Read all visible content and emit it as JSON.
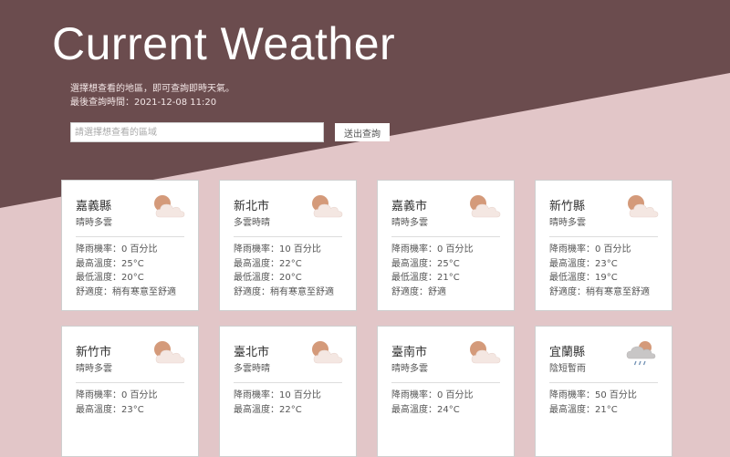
{
  "header": {
    "title": "Current Weather",
    "desc_line1": "選擇想查看的地區，即可查詢即時天氣。",
    "desc_line2": "最後查詢時間：2021-12-08 11:20"
  },
  "search": {
    "placeholder": "請選擇想查看的區域",
    "button_label": "送出查詢"
  },
  "cards": [
    {
      "city": "嘉義縣",
      "condition": "晴時多雲",
      "icon": "partly-cloudy-icon",
      "rain": "降雨機率：0 百分比",
      "max": "最高溫度：25°C",
      "min": "最低溫度：20°C",
      "comfort": "舒適度：稍有寒意至舒適"
    },
    {
      "city": "新北市",
      "condition": "多雲時晴",
      "icon": "partly-cloudy-icon",
      "rain": "降雨機率：10 百分比",
      "max": "最高溫度：22°C",
      "min": "最低溫度：20°C",
      "comfort": "舒適度：稍有寒意至舒適"
    },
    {
      "city": "嘉義市",
      "condition": "晴時多雲",
      "icon": "partly-cloudy-icon",
      "rain": "降雨機率：0 百分比",
      "max": "最高溫度：25°C",
      "min": "最低溫度：21°C",
      "comfort": "舒適度：舒適"
    },
    {
      "city": "新竹縣",
      "condition": "晴時多雲",
      "icon": "partly-cloudy-icon",
      "rain": "降雨機率：0 百分比",
      "max": "最高溫度：23°C",
      "min": "最低溫度：19°C",
      "comfort": "舒適度：稍有寒意至舒適"
    },
    {
      "city": "新竹市",
      "condition": "晴時多雲",
      "icon": "partly-cloudy-icon",
      "rain": "降雨機率：0 百分比",
      "max": "最高溫度：23°C",
      "min": "",
      "comfort": ""
    },
    {
      "city": "臺北市",
      "condition": "多雲時晴",
      "icon": "partly-cloudy-icon",
      "rain": "降雨機率：10 百分比",
      "max": "最高溫度：22°C",
      "min": "",
      "comfort": ""
    },
    {
      "city": "臺南市",
      "condition": "晴時多雲",
      "icon": "partly-cloudy-icon",
      "rain": "降雨機率：0 百分比",
      "max": "最高溫度：24°C",
      "min": "",
      "comfort": ""
    },
    {
      "city": "宜蘭縣",
      "condition": "陰短暫雨",
      "icon": "rain-cloud-icon",
      "rain": "降雨機率：50 百分比",
      "max": "最高溫度：21°C",
      "min": "",
      "comfort": ""
    }
  ],
  "colors": {
    "header_bg": "#6b4c4e",
    "page_bg": "#e2c6c8",
    "sun": "#d49a7a",
    "cloud": "#f4e7e2"
  }
}
